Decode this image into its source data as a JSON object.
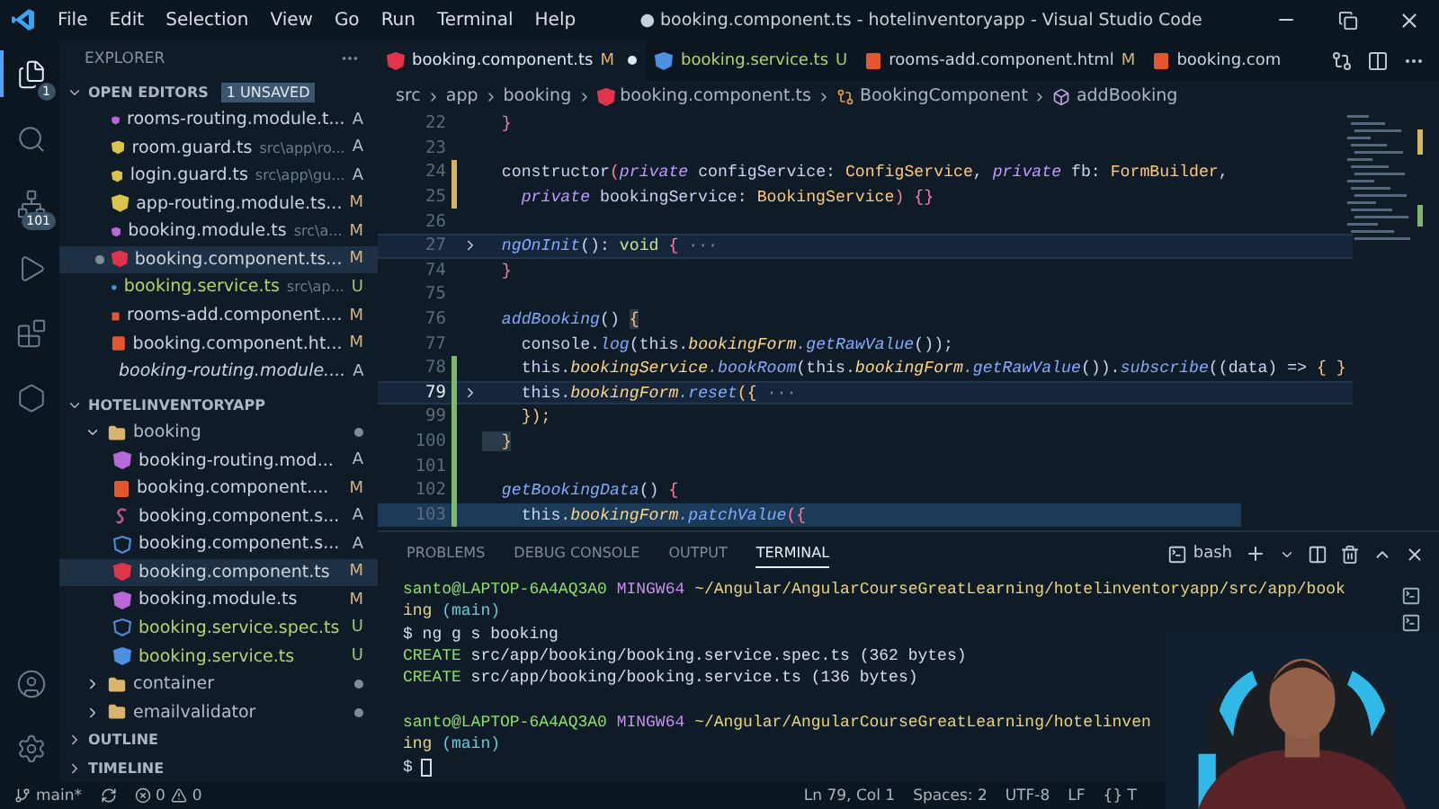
{
  "title_bar": {
    "menus": [
      "File",
      "Edit",
      "Selection",
      "View",
      "Go",
      "Run",
      "Terminal",
      "Help"
    ],
    "title": "● booking.component.ts - hotelinventoryapp - Visual Studio Code"
  },
  "activity_bar": [
    {
      "kind": "explorer",
      "badge": "1",
      "selected": true
    },
    {
      "kind": "search",
      "selected": false
    },
    {
      "kind": "source-control",
      "badge": "101",
      "selected": false
    },
    {
      "kind": "run",
      "selected": false
    },
    {
      "kind": "extensions",
      "selected": false
    },
    {
      "kind": "nx",
      "selected": false
    }
  ],
  "sidebar": {
    "title": "EXPLORER",
    "open_editors": {
      "title": "OPEN EDITORS",
      "badge": "1 UNSAVED",
      "expanded": true,
      "items": [
        {
          "label": "rooms-routing.module.t...",
          "status": "A",
          "kind": "angular-module",
          "selected": false,
          "dirty": false,
          "preview": false
        },
        {
          "label": "room.guard.ts",
          "description": "src\\app\\ro...",
          "status": "A",
          "kind": "guard",
          "selected": false,
          "dirty": false,
          "preview": false
        },
        {
          "label": "login.guard.ts",
          "description": "src\\app\\gu...",
          "status": "A",
          "kind": "guard",
          "selected": false,
          "dirty": false,
          "preview": false
        },
        {
          "label": "app-routing.module.ts...",
          "status": "M",
          "kind": "guard",
          "selected": false,
          "dirty": false,
          "preview": false
        },
        {
          "label": "booking.module.ts",
          "description": "src\\a...",
          "status": "M",
          "kind": "angular-module",
          "selected": false,
          "dirty": false,
          "preview": false
        },
        {
          "label": "booking.component.ts...",
          "status": "M",
          "kind": "angular-component",
          "selected": true,
          "dirty": true,
          "preview": false
        },
        {
          "label": "booking.service.ts",
          "description": "src\\ap...",
          "status": "U",
          "kind": "angular-service",
          "selected": false,
          "dirty": false,
          "preview": false
        },
        {
          "label": "rooms-add.component....",
          "status": "M",
          "kind": "html",
          "selected": false,
          "dirty": false,
          "preview": false
        },
        {
          "label": "booking.component.ht...",
          "status": "M",
          "kind": "html",
          "selected": false,
          "dirty": false,
          "preview": false
        },
        {
          "label": "booking-routing.module....",
          "status": "A",
          "kind": "angular-module",
          "selected": false,
          "dirty": false,
          "preview": true
        }
      ]
    },
    "project": {
      "title": "HOTELINVENTORYAPP",
      "expanded": true,
      "tree": [
        {
          "label": "booking",
          "kind": "folder",
          "expanded": true,
          "children": [
            {
              "label": "booking-routing.mod...",
              "kind": "angular-module",
              "status": "A",
              "selected": false
            },
            {
              "label": "booking.component....",
              "kind": "html",
              "status": "M",
              "selected": false
            },
            {
              "label": "booking.component.s...",
              "kind": "sass",
              "status": "A",
              "selected": false
            },
            {
              "label": "booking.component.s...",
              "kind": "angular-spec",
              "status": "A",
              "selected": false
            },
            {
              "label": "booking.component.ts",
              "kind": "angular-component",
              "status": "M",
              "selected": true
            },
            {
              "label": "booking.module.ts",
              "kind": "angular-module",
              "status": "M",
              "selected": false
            },
            {
              "label": "booking.service.spec.ts",
              "kind": "angular-spec",
              "status": "U",
              "selected": false
            },
            {
              "label": "booking.service.ts",
              "kind": "angular-service",
              "status": "U",
              "selected": false
            }
          ]
        },
        {
          "label": "container",
          "kind": "folder",
          "expanded": false
        },
        {
          "label": "emailvalidator",
          "kind": "folder",
          "expanded": false
        }
      ]
    },
    "sections": [
      {
        "title": "OUTLINE",
        "expanded": false
      },
      {
        "title": "TIMELINE",
        "expanded": false
      }
    ]
  },
  "tabs": [
    {
      "label": "booking.component.ts",
      "status": "M",
      "kind": "angular-component",
      "selected": true,
      "dirty": true
    },
    {
      "label": "booking.service.ts",
      "status": "U",
      "kind": "angular-service",
      "selected": false,
      "dirty": false
    },
    {
      "label": "rooms-add.component.html",
      "status": "M",
      "kind": "html",
      "selected": false,
      "dirty": false
    },
    {
      "label": "booking.com",
      "kind": "html",
      "selected": false,
      "dirty": false
    }
  ],
  "breadcrumb": [
    {
      "label": "src",
      "kind": "folder"
    },
    {
      "label": "app",
      "kind": "folder"
    },
    {
      "label": "booking",
      "kind": "folder"
    },
    {
      "label": "booking.component.ts",
      "kind": "file"
    },
    {
      "label": "BookingComponent",
      "kind": "class"
    },
    {
      "label": "addBooking",
      "kind": "method"
    }
  ],
  "code_lines": [
    {
      "num": "22",
      "kind": "plain",
      "fold": false,
      "current": false,
      "highlighted": false,
      "selected": false,
      "tokens": [
        {
          "text": "  }",
          "kind": "brace"
        }
      ]
    },
    {
      "num": "23",
      "kind": "plain",
      "fold": false,
      "current": false,
      "highlighted": false,
      "selected": false
    },
    {
      "num": "24",
      "kind": "modified",
      "fold": false,
      "current": false,
      "highlighted": false,
      "selected": false,
      "tokens": [
        {
          "text": "  constructor",
          "kind": "plain"
        },
        {
          "text": "(",
          "kind": "brace"
        },
        {
          "text": "private",
          "kind": "kw"
        },
        {
          "text": " configService: ",
          "kind": "plain"
        },
        {
          "text": "ConfigService",
          "kind": "type"
        },
        {
          "text": ", ",
          "kind": "plain"
        },
        {
          "text": "private",
          "kind": "kw"
        },
        {
          "text": " fb: ",
          "kind": "plain"
        },
        {
          "text": "FormBuilder",
          "kind": "type"
        },
        {
          "text": ",",
          "kind": "plain"
        }
      ]
    },
    {
      "num": "25",
      "kind": "modified",
      "fold": false,
      "current": false,
      "highlighted": false,
      "selected": false,
      "tokens": [
        {
          "text": "    private",
          "kind": "kw"
        },
        {
          "text": " bookingService: ",
          "kind": "plain"
        },
        {
          "text": "BookingService",
          "kind": "type"
        },
        {
          "text": ") {}",
          "kind": "brace"
        }
      ]
    },
    {
      "num": "26",
      "kind": "plain",
      "fold": false,
      "current": false,
      "highlighted": false,
      "selected": false
    },
    {
      "num": "27",
      "kind": "plain",
      "fold": true,
      "current": false,
      "highlighted": true,
      "selected": false,
      "tokens": [
        {
          "text": "  ngOnInit",
          "kind": "fn"
        },
        {
          "text": "(): ",
          "kind": "plain"
        },
        {
          "text": "void",
          "kind": "void"
        },
        {
          "text": " {",
          "kind": "brace"
        },
        {
          "text": " ···",
          "kind": "fold"
        }
      ]
    },
    {
      "num": "74",
      "kind": "plain",
      "fold": false,
      "current": false,
      "highlighted": false,
      "selected": false,
      "tokens": [
        {
          "text": "  }",
          "kind": "brace"
        }
      ]
    },
    {
      "num": "75",
      "kind": "plain",
      "fold": false,
      "current": false,
      "highlighted": false,
      "selected": false
    },
    {
      "num": "76",
      "kind": "plain",
      "fold": false,
      "current": false,
      "highlighted": false,
      "selected": false,
      "tokens": [
        {
          "text": "  addBooking",
          "kind": "fn"
        },
        {
          "text": "() ",
          "kind": "plain"
        },
        {
          "text": "{",
          "kind": "match"
        }
      ]
    },
    {
      "num": "77",
      "kind": "plain",
      "fold": false,
      "current": false,
      "highlighted": false,
      "selected": false,
      "tokens": [
        {
          "text": "    console.",
          "kind": "plain"
        },
        {
          "text": "log",
          "kind": "method"
        },
        {
          "text": "(this.",
          "kind": "plain"
        },
        {
          "text": "bookingForm",
          "kind": "prop"
        },
        {
          "text": ".getRawValue",
          "kind": "method"
        },
        {
          "text": "());",
          "kind": "plain"
        }
      ]
    },
    {
      "num": "78",
      "kind": "added",
      "fold": false,
      "current": false,
      "highlighted": false,
      "selected": false,
      "tokens": [
        {
          "text": "    this.",
          "kind": "plain"
        },
        {
          "text": "bookingService",
          "kind": "prop"
        },
        {
          "text": ".bookRoom",
          "kind": "method"
        },
        {
          "text": "(this.",
          "kind": "plain"
        },
        {
          "text": "bookingForm",
          "kind": "prop"
        },
        {
          "text": ".getRawValue",
          "kind": "method"
        },
        {
          "text": "()).",
          "kind": "plain"
        },
        {
          "text": "subscribe",
          "kind": "method"
        },
        {
          "text": "((data) => ",
          "kind": "plain"
        },
        {
          "text": "{ }",
          "kind": "type"
        }
      ]
    },
    {
      "num": "79",
      "kind": "added",
      "fold": true,
      "current": true,
      "highlighted": true,
      "selected": false,
      "tokens": [
        {
          "text": "    this.",
          "kind": "plain"
        },
        {
          "text": "bookingForm",
          "kind": "prop"
        },
        {
          "text": ".reset",
          "kind": "method"
        },
        {
          "text": "({",
          "kind": "type"
        },
        {
          "text": " ···",
          "kind": "fold"
        }
      ]
    },
    {
      "num": "99",
      "kind": "added",
      "fold": false,
      "current": false,
      "highlighted": false,
      "selected": false,
      "tokens": [
        {
          "text": "    });",
          "kind": "type"
        }
      ]
    },
    {
      "num": "100",
      "kind": "added",
      "fold": false,
      "current": false,
      "highlighted": false,
      "selected": false,
      "tokens": [
        {
          "text": "  }",
          "kind": "match"
        }
      ]
    },
    {
      "num": "101",
      "kind": "added",
      "fold": false,
      "current": false,
      "highlighted": false,
      "selected": false
    },
    {
      "num": "102",
      "kind": "added",
      "fold": false,
      "current": false,
      "highlighted": false,
      "selected": false,
      "tokens": [
        {
          "text": "  getBookingData",
          "kind": "fn"
        },
        {
          "text": "() ",
          "kind": "plain"
        },
        {
          "text": "{",
          "kind": "brace"
        }
      ]
    },
    {
      "num": "103",
      "kind": "added",
      "fold": false,
      "current": false,
      "highlighted": false,
      "selected": true,
      "tokens": [
        {
          "text": "    this.",
          "kind": "plain"
        },
        {
          "text": "bookingForm",
          "kind": "prop"
        },
        {
          "text": ".patchValue",
          "kind": "method"
        },
        {
          "text": "({",
          "kind": "brace"
        }
      ]
    }
  ],
  "panel": {
    "tabs": [
      {
        "label": "PROBLEMS",
        "selected": false
      },
      {
        "label": "DEBUG CONSOLE",
        "selected": false
      },
      {
        "label": "OUTPUT",
        "selected": false
      },
      {
        "label": "TERMINAL",
        "selected": true
      }
    ],
    "shell": "bash",
    "terminal_lines": [
      {
        "kind": "text",
        "tokens": [
          {
            "text": "santo@LAPTOP-6A4AQ3A0",
            "kind": "user"
          },
          {
            "text": " MINGW64",
            "kind": "host"
          },
          {
            "text": " ~/Angular/AngularCourseGreatLearning/hotelinventoryapp/src/app/book",
            "kind": "path"
          }
        ]
      },
      {
        "kind": "text",
        "tokens": [
          {
            "text": "ing",
            "kind": "path"
          },
          {
            "text": " (main)",
            "kind": "branch"
          }
        ]
      },
      {
        "kind": "text",
        "tokens": [
          {
            "text": "$ ng g s booking",
            "kind": "plain"
          }
        ]
      },
      {
        "kind": "text",
        "tokens": [
          {
            "text": "CREATE",
            "kind": "user"
          },
          {
            "text": " src/app/booking/booking.service.spec.ts (362 bytes)",
            "kind": "plain"
          }
        ]
      },
      {
        "kind": "text",
        "tokens": [
          {
            "text": "CREATE",
            "kind": "user"
          },
          {
            "text": " src/app/booking/booking.service.ts (136 bytes)",
            "kind": "plain"
          }
        ]
      },
      {
        "kind": "blank"
      },
      {
        "kind": "text",
        "tokens": [
          {
            "text": "santo@LAPTOP-6A4AQ3A0",
            "kind": "user"
          },
          {
            "text": " MINGW64",
            "kind": "host"
          },
          {
            "text": " ~/Angular/AngularCourseGreatLearning/hotelinven",
            "kind": "path"
          }
        ]
      },
      {
        "kind": "text",
        "tokens": [
          {
            "text": "ing",
            "kind": "path"
          },
          {
            "text": " (main)",
            "kind": "branch"
          }
        ]
      },
      {
        "kind": "text",
        "tokens": [
          {
            "text": "$",
            "kind": "plain"
          },
          {
            "kind": "cursor"
          }
        ]
      }
    ]
  },
  "status_bar": {
    "branch": "main*",
    "errors": "0",
    "warnings": "0",
    "items": [
      "Ln 79, Col 1",
      "Spaces: 2",
      "UTF-8",
      "LF",
      "{} T"
    ]
  }
}
